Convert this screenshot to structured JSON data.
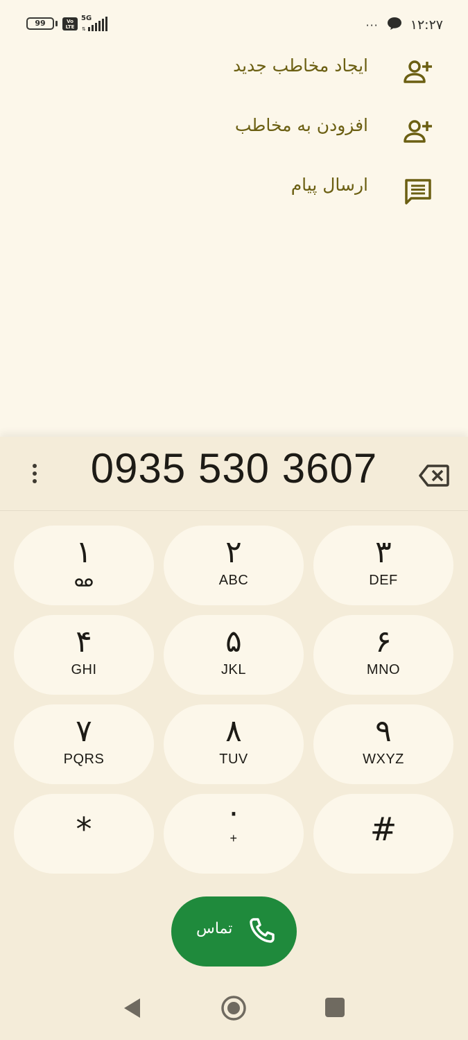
{
  "status_bar": {
    "battery": "99",
    "volte": "Vo LTE",
    "network": "5G",
    "time": "۱۲:۲۷",
    "more": "···",
    "notification_icon": "chat-bubble-icon"
  },
  "actions": [
    {
      "label": "ایجاد مخاطب جدید",
      "icon": "person-add-icon"
    },
    {
      "label": "افزودن به مخاطب",
      "icon": "person-add-icon"
    },
    {
      "label": "ارسال پیام",
      "icon": "message-icon"
    }
  ],
  "dialer": {
    "number": "0935 530 3607",
    "overflow_icon": "more-vert-icon",
    "backspace_icon": "backspace-icon"
  },
  "keypad": [
    {
      "digit": "۱",
      "letters": "",
      "extra": "voicemail-icon"
    },
    {
      "digit": "۲",
      "letters": "ABC"
    },
    {
      "digit": "۳",
      "letters": "DEF"
    },
    {
      "digit": "۴",
      "letters": "GHI"
    },
    {
      "digit": "۵",
      "letters": "JKL"
    },
    {
      "digit": "۶",
      "letters": "MNO"
    },
    {
      "digit": "۷",
      "letters": "PQRS"
    },
    {
      "digit": "۸",
      "letters": "TUV"
    },
    {
      "digit": "۹",
      "letters": "WXYZ"
    },
    {
      "digit": "*",
      "letters": ""
    },
    {
      "digit": "۰",
      "letters": "+"
    },
    {
      "digit": "#",
      "letters": ""
    }
  ],
  "call_button": {
    "label": "تماس",
    "icon": "phone-icon"
  },
  "colors": {
    "background": "#fcf7ea",
    "sheet": "#f4ecd9",
    "accent_text": "#6b5f12",
    "call_green": "#1f8a3c"
  },
  "nav_bar": {
    "back": "back-icon",
    "home": "home-icon",
    "recents": "recents-icon"
  }
}
